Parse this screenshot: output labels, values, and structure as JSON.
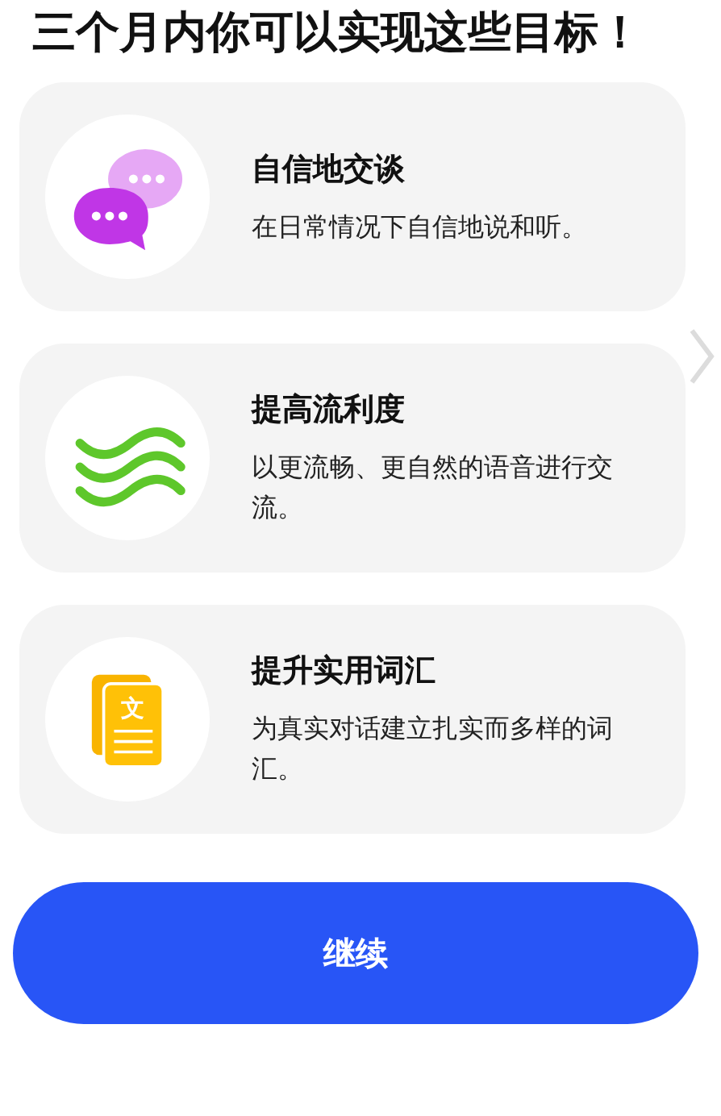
{
  "heading": "三个月内你可以实现这些目标！",
  "goals": [
    {
      "kind": "chat",
      "title": "自信地交谈",
      "description": "在日常情况下自信地说和听。"
    },
    {
      "kind": "waves",
      "title": "提高流利度",
      "description": "以更流畅、更自然的语音进行交流。"
    },
    {
      "kind": "document",
      "icon_char": "文",
      "title": "提升实用词汇",
      "description": "为真实对话建立扎实而多样的词汇。"
    }
  ],
  "continue_button": "继续"
}
